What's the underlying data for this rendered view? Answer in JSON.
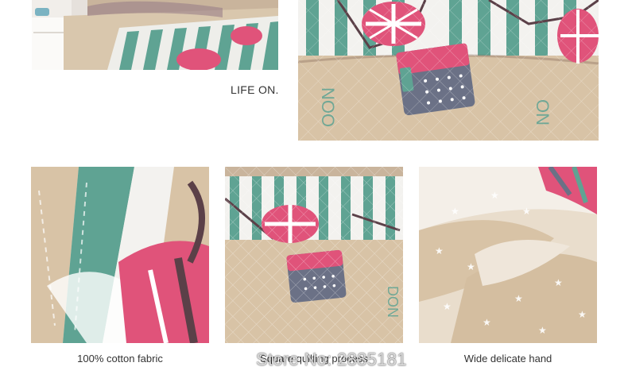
{
  "tagline": "LIFE ON.",
  "photos": [
    {
      "caption": "100% cotton fabric"
    },
    {
      "caption": "Square quilting process"
    },
    {
      "caption": "Wide delicate hand"
    }
  ],
  "watermark": "Store No: 2885181",
  "colors": {
    "teal": "#5fa393",
    "pink": "#e0537a",
    "beige": "#d8c3a6",
    "navy": "#6b7186",
    "cream": "#efe6da"
  }
}
